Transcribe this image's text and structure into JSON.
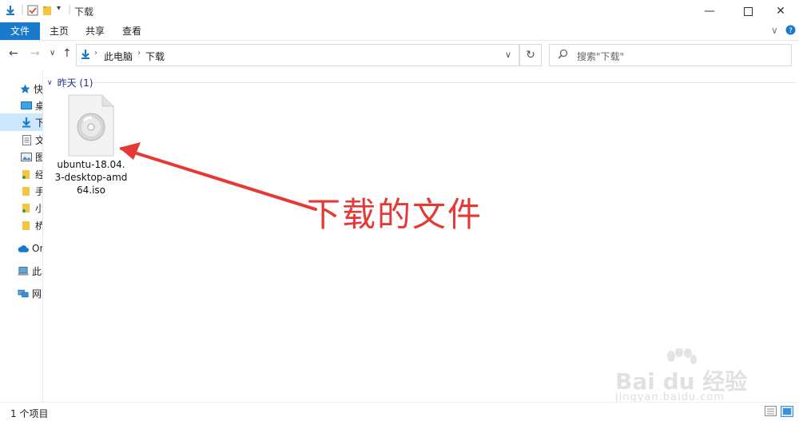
{
  "window": {
    "title": "下载"
  },
  "ribbon": {
    "tabs": [
      "文件",
      "主页",
      "共享",
      "查看"
    ]
  },
  "address": {
    "crumbs": [
      "此电脑",
      "下载"
    ],
    "search_placeholder": "搜索\"下载\""
  },
  "sidebar": {
    "items": [
      {
        "label": "快",
        "icon": "star-icon"
      },
      {
        "label": "桌",
        "icon": "desktop-icon"
      },
      {
        "label": "下",
        "icon": "download-icon"
      },
      {
        "label": "文",
        "icon": "document-icon"
      },
      {
        "label": "图",
        "icon": "picture-icon"
      },
      {
        "label": "经",
        "icon": "folder-icon"
      },
      {
        "label": "手",
        "icon": "folder-icon"
      },
      {
        "label": "小",
        "icon": "folder-icon"
      },
      {
        "label": "桥",
        "icon": "folder-icon"
      },
      {
        "label": "On",
        "icon": "cloud-icon"
      },
      {
        "label": "此",
        "icon": "computer-icon"
      },
      {
        "label": "网",
        "icon": "network-icon"
      }
    ]
  },
  "content": {
    "group_label": "昨天 (1)",
    "file": {
      "name": "ubuntu-18.04.3-desktop-amd64.iso",
      "icon": "disc-image-icon"
    }
  },
  "annotation": {
    "text": "下载的文件",
    "color": "#e53935"
  },
  "status": {
    "count": "1 个项目"
  },
  "watermark": {
    "brand": "Bai du 经验",
    "url": "jingyan.baidu.com"
  },
  "colors": {
    "accent": "#1979ca",
    "selection": "#cce8ff",
    "annotation": "#e53935"
  }
}
